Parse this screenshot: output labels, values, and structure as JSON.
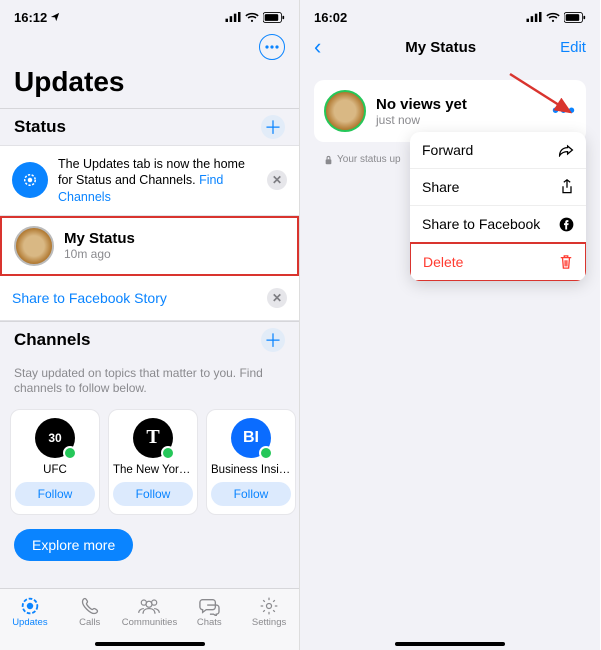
{
  "left": {
    "statusbar": {
      "time": "16:12"
    },
    "page_title": "Updates",
    "status_section": {
      "title": "Status",
      "info_text": "The Updates tab is now the home for Status and Channels. ",
      "info_link": "Find Channels",
      "my_status_title": "My Status",
      "my_status_sub": "10m ago",
      "share_fb": "Share to Facebook Story"
    },
    "channels_section": {
      "title": "Channels",
      "desc": "Stay updated on topics that matter to you. Find channels to follow below.",
      "cards": [
        {
          "name": "UFC",
          "logo": "30",
          "follow": "Follow"
        },
        {
          "name": "The New York...",
          "logo": "T",
          "follow": "Follow"
        },
        {
          "name": "Business Insid...",
          "logo": "BI",
          "follow": "Follow",
          "bg": "#0a6cff"
        }
      ],
      "explore": "Explore more"
    },
    "tabs": [
      {
        "label": "Updates"
      },
      {
        "label": "Calls"
      },
      {
        "label": "Communities"
      },
      {
        "label": "Chats"
      },
      {
        "label": "Settings"
      }
    ]
  },
  "right": {
    "statusbar": {
      "time": "16:02"
    },
    "nav": {
      "title": "My Status",
      "edit": "Edit"
    },
    "card": {
      "title": "No views yet",
      "sub": "just now"
    },
    "privacy_note": "Your status up",
    "menu": [
      {
        "label": "Forward",
        "icon": "forward"
      },
      {
        "label": "Share",
        "icon": "share"
      },
      {
        "label": "Share to Facebook",
        "icon": "facebook"
      },
      {
        "label": "Delete",
        "icon": "trash",
        "destructive": true
      }
    ]
  }
}
